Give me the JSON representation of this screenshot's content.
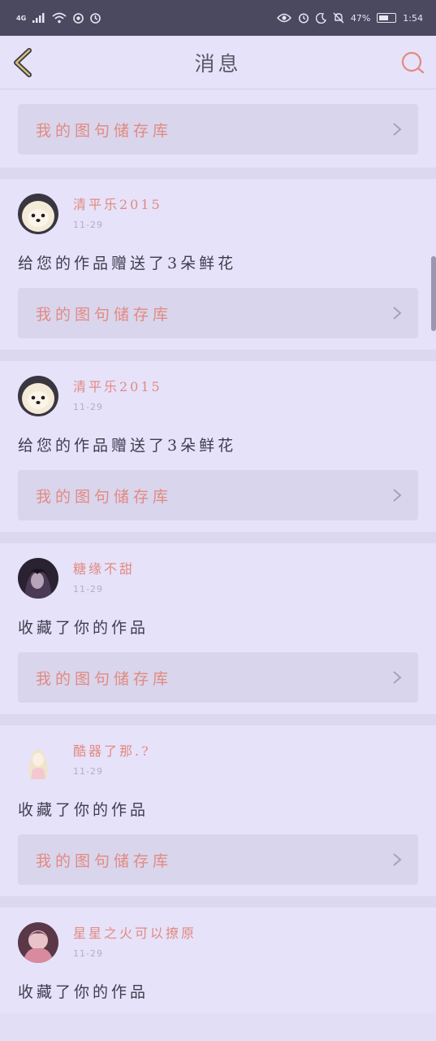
{
  "status_bar": {
    "network": "4G",
    "battery_percent": "47%",
    "time": "1:54",
    "left_icons": [
      "signal-icon",
      "wifi-icon",
      "record-icon",
      "app-icon"
    ],
    "right_icons": [
      "eye-icon",
      "alarm-icon",
      "moon-icon",
      "bell-off-icon",
      "battery-icon"
    ]
  },
  "header": {
    "title": "消息",
    "back_icon": "chevron-left-icon",
    "search_icon": "search-icon"
  },
  "colors": {
    "accent": "#e28a80",
    "background": "#e6e2fa",
    "link_box": "#d9d5ec",
    "status_bar": "#4a4960"
  },
  "feed": {
    "first_link_label": "我的图句储存库",
    "items": [
      {
        "user_name": "清平乐2015",
        "date": "11-29",
        "message": "给您的作品赠送了3朵鲜花",
        "link_label": "我的图句储存库",
        "avatar": "dog-avatar"
      },
      {
        "user_name": "清平乐2015",
        "date": "11-29",
        "message": "给您的作品赠送了3朵鲜花",
        "link_label": "我的图句储存库",
        "avatar": "dog-avatar"
      },
      {
        "user_name": "糖缘不甜",
        "date": "11-29",
        "message": "收藏了你的作品",
        "link_label": "我的图句储存库",
        "avatar": "dark-girl-avatar"
      },
      {
        "user_name": "酷器了那.?",
        "date": "11-29",
        "message": "收藏了你的作品",
        "link_label": "我的图句储存库",
        "avatar": "anime-girl-avatar"
      },
      {
        "user_name": "星星之火可以撩原",
        "date": "11-29",
        "message": "收藏了你的作品",
        "avatar": "pink-avatar"
      }
    ]
  }
}
